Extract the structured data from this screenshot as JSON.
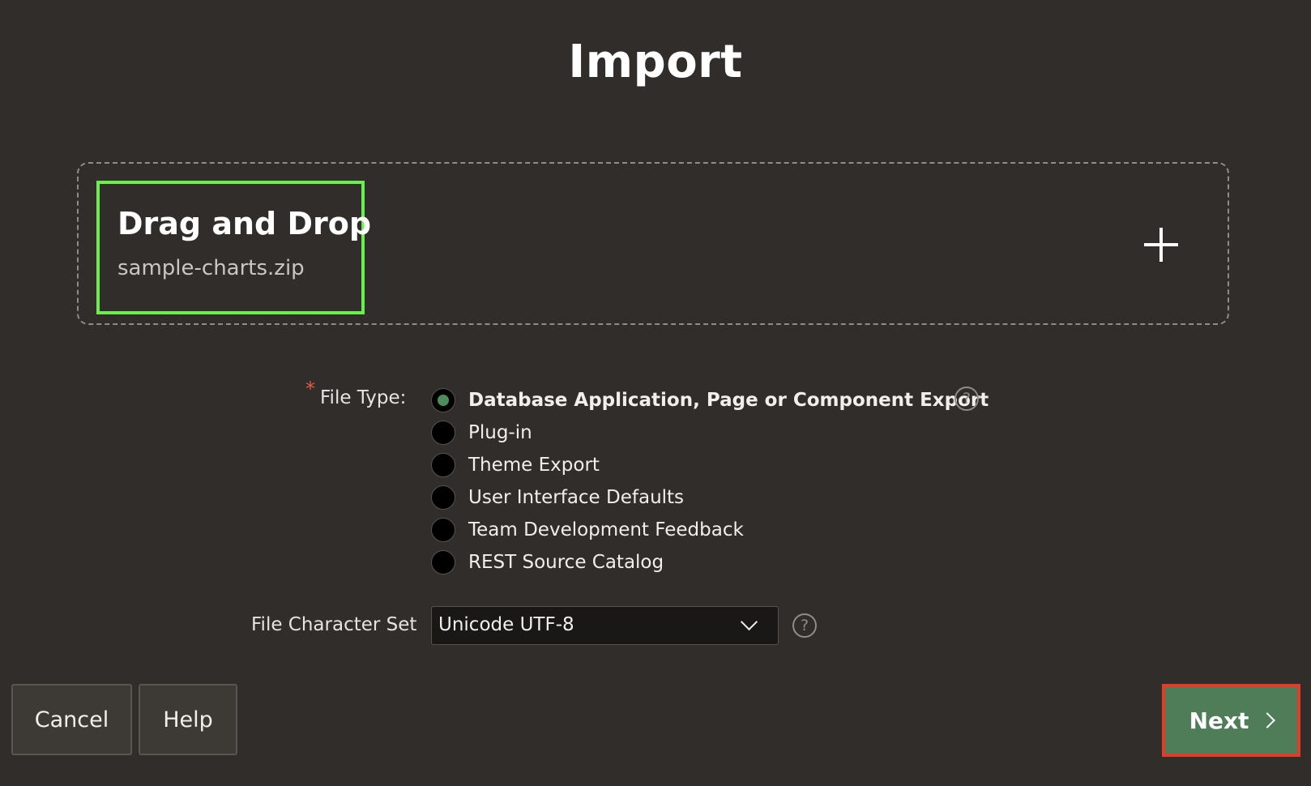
{
  "page": {
    "title": "Import"
  },
  "dropzone": {
    "heading": "Drag and Drop",
    "filename": "sample-charts.zip",
    "add_icon": "plus-icon"
  },
  "file_type": {
    "label": "File Type:",
    "required_marker": "*",
    "options": [
      {
        "label": "Database Application, Page or Component Export",
        "selected": true
      },
      {
        "label": "Plug-in",
        "selected": false
      },
      {
        "label": "Theme Export",
        "selected": false
      },
      {
        "label": "User Interface Defaults",
        "selected": false
      },
      {
        "label": "Team Development Feedback",
        "selected": false
      },
      {
        "label": "REST Source Catalog",
        "selected": false
      }
    ],
    "help_glyph": "?"
  },
  "charset": {
    "label": "File Character Set",
    "value": "Unicode UTF-8",
    "help_glyph": "?"
  },
  "buttons": {
    "cancel": "Cancel",
    "help": "Help",
    "next": "Next"
  },
  "colors": {
    "background": "#312d2a",
    "dropzone_highlight": "#6bef4c",
    "next_button": "#4f7d57",
    "next_highlight": "#e23d2a",
    "required": "#e05a47"
  }
}
